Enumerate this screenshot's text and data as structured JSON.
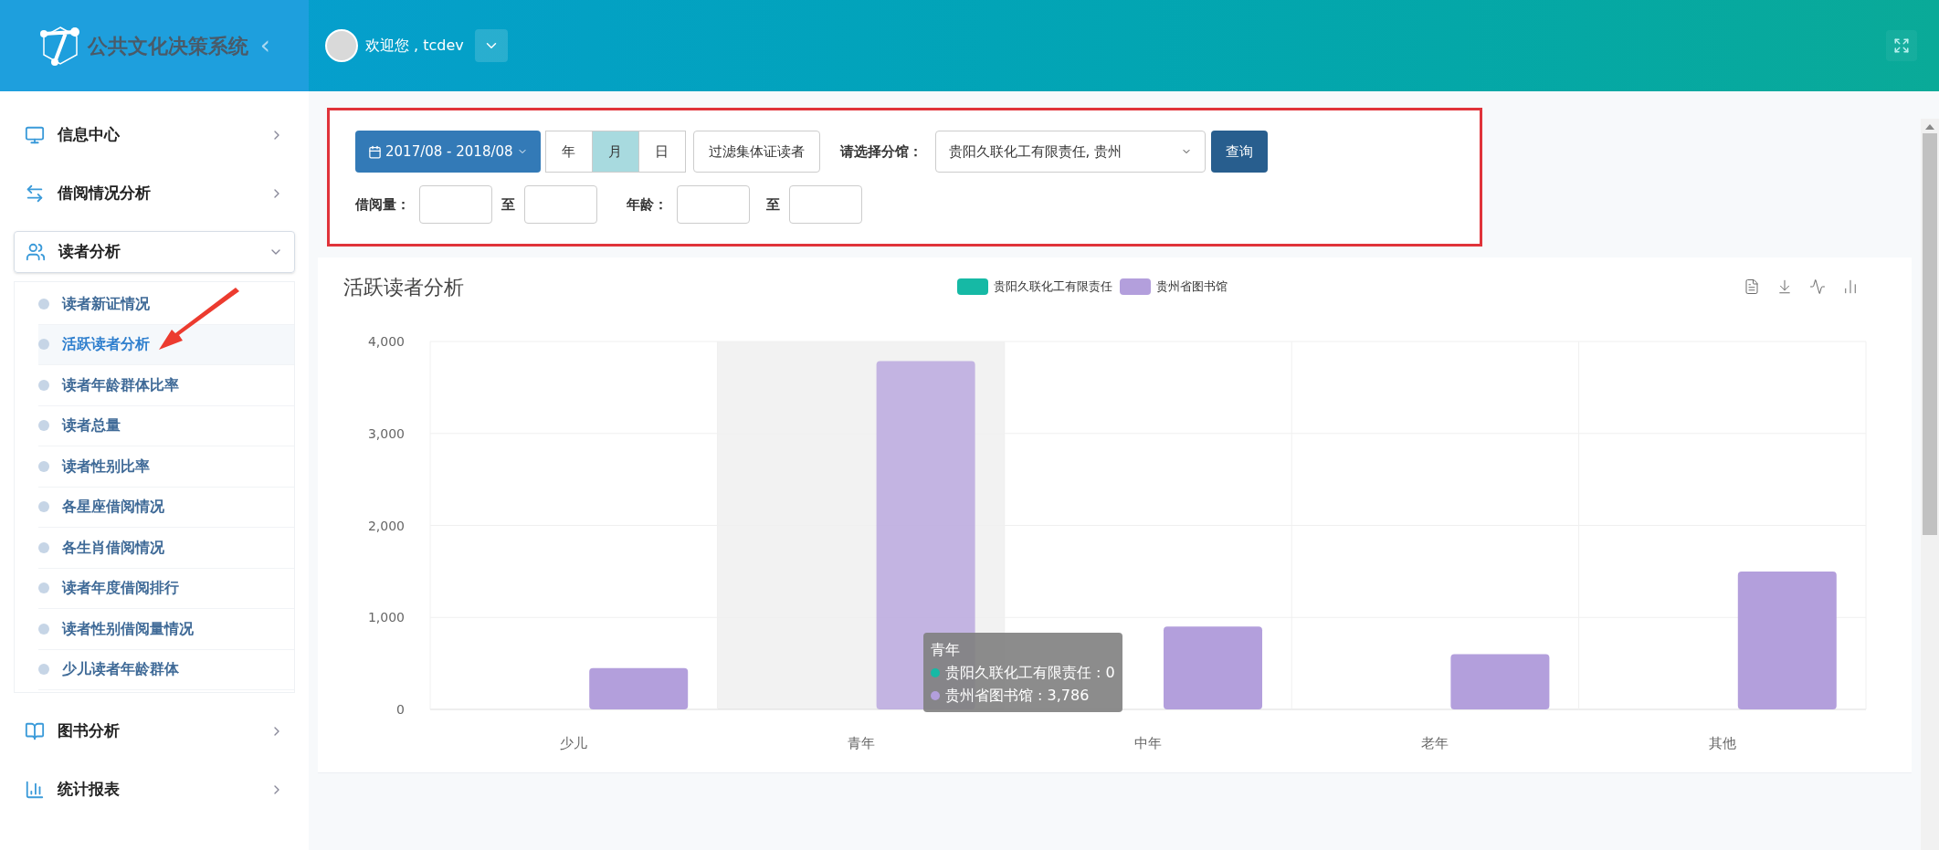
{
  "header": {
    "title": "公共文化决策系统",
    "collapse": "‹",
    "welcome": "欢迎您 , tcdev"
  },
  "sidebar": {
    "items": [
      {
        "label": "信息中心",
        "expanded": false
      },
      {
        "label": "借阅情况分析",
        "expanded": false
      },
      {
        "label": "读者分析",
        "expanded": true,
        "children": [
          {
            "label": "读者新证情况",
            "selected": false
          },
          {
            "label": "活跃读者分析",
            "selected": true
          },
          {
            "label": "读者年龄群体比率",
            "selected": false
          },
          {
            "label": "读者总量",
            "selected": false
          },
          {
            "label": "读者性别比率",
            "selected": false
          },
          {
            "label": "各星座借阅情况",
            "selected": false
          },
          {
            "label": "各生肖借阅情况",
            "selected": false
          },
          {
            "label": "读者年度借阅排行",
            "selected": false
          },
          {
            "label": "读者性别借阅量情况",
            "selected": false
          },
          {
            "label": "少儿读者年龄群体",
            "selected": false
          }
        ]
      },
      {
        "label": "图书分析",
        "expanded": false
      },
      {
        "label": "统计报表",
        "expanded": false
      }
    ]
  },
  "filters": {
    "date_range": "2017/08 - 2018/08",
    "granularity": [
      {
        "label": "年",
        "selected": false
      },
      {
        "label": "月",
        "selected": true
      },
      {
        "label": "日",
        "selected": false
      }
    ],
    "collective_filter": "过滤集体证读者",
    "branch_label": "请选择分馆：",
    "branch_value": "贵阳久联化工有限责任, 贵州",
    "query": "查询",
    "borrow_label": "借阅量：",
    "to_1": "至",
    "age_label": "年龄：",
    "to_2": "至"
  },
  "chart": {
    "title": "活跃读者分析",
    "chart_data": {
      "type": "bar",
      "grid": true,
      "categories": [
        "少儿",
        "青年",
        "中年",
        "老年",
        "其他"
      ],
      "series": [
        {
          "name": "贵阳久联化工有限责任",
          "color": "#16b9a5",
          "values": [
            0,
            0,
            0,
            0,
            0
          ]
        },
        {
          "name": "贵州省图书馆",
          "color": "#b39fdc",
          "values": [
            450,
            3786,
            900,
            600,
            1500
          ]
        }
      ],
      "ylim": [
        0,
        4000
      ],
      "yticks": [
        {
          "value": 0,
          "label": "0"
        },
        {
          "value": 1000,
          "label": "1,000"
        },
        {
          "value": 2000,
          "label": "2,000"
        },
        {
          "value": 3000,
          "label": "3,000"
        },
        {
          "value": 4000,
          "label": "4,000"
        }
      ]
    },
    "tooltip": {
      "title": "青年",
      "rows": [
        "贵阳久联化工有限责任 : 0",
        "贵州省图书馆 : 3,786"
      ]
    }
  }
}
